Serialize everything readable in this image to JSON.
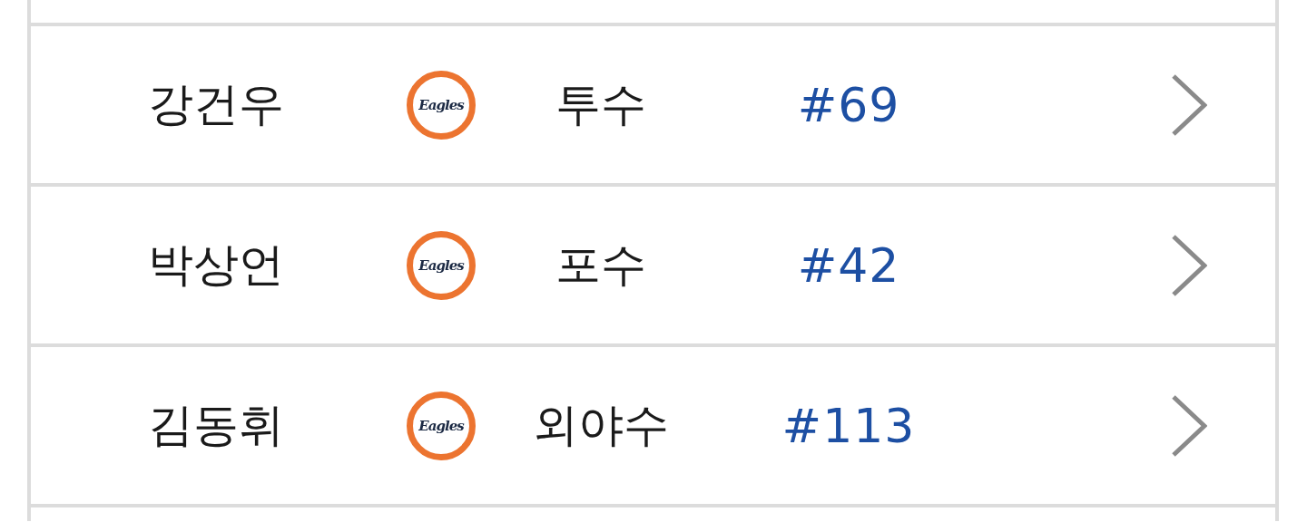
{
  "players": [
    {
      "name": "강건우",
      "logo_text": "Eagles",
      "position": "투수",
      "number": "#69"
    },
    {
      "name": "박상언",
      "logo_text": "Eagles",
      "position": "포수",
      "number": "#42"
    },
    {
      "name": "김동휘",
      "logo_text": "Eagles",
      "position": "외야수",
      "number": "#113"
    }
  ]
}
